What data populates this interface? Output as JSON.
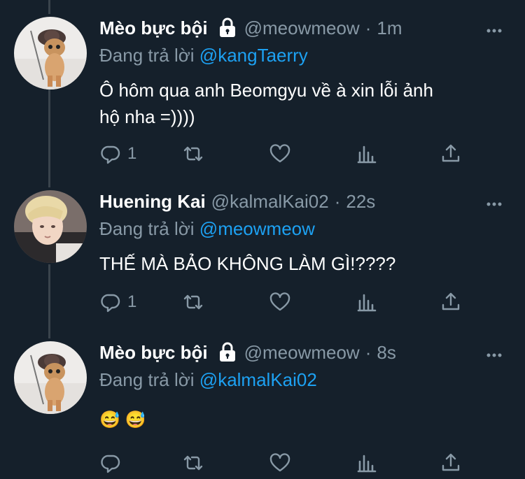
{
  "tweets": [
    {
      "display_name": "Mèo bực bội",
      "protected": true,
      "handle": "@meowmeow",
      "separator": "·",
      "time": "1m",
      "replying_prefix": "Đang trả lời",
      "replying_to": "@kangTaerry",
      "text_line1": "Ô hôm qua anh Beomgyu về à xin lỗi ảnh",
      "text_line2": "hộ nha =))))",
      "reply_count": "1",
      "avatar": "cat-avatar"
    },
    {
      "display_name": "Huening Kai",
      "protected": false,
      "handle": "@kalmalKai02",
      "separator": "·",
      "time": "22s",
      "replying_prefix": "Đang trả lời",
      "replying_to": "@meowmeow",
      "text_line1": "THẾ MÀ BẢO KHÔNG LÀM GÌ!????",
      "reply_count": "1",
      "avatar": "person-avatar"
    },
    {
      "display_name": "Mèo bực bội",
      "protected": true,
      "handle": "@meowmeow",
      "separator": "·",
      "time": "8s",
      "replying_prefix": "Đang trả lời",
      "replying_to": "@kalmalKai02",
      "text_line1": "😅 😅",
      "reply_count": "",
      "avatar": "cat-avatar"
    }
  ],
  "icons": {
    "reply": "reply-icon",
    "retweet": "retweet-icon",
    "like": "like-icon",
    "analytics": "analytics-icon",
    "share": "share-icon",
    "more": "more-icon",
    "lock": "lock-icon"
  },
  "colors": {
    "background": "#15202b",
    "secondary_text": "#8899a6",
    "mention": "#1da1f2",
    "thread_line": "#3a444c"
  }
}
